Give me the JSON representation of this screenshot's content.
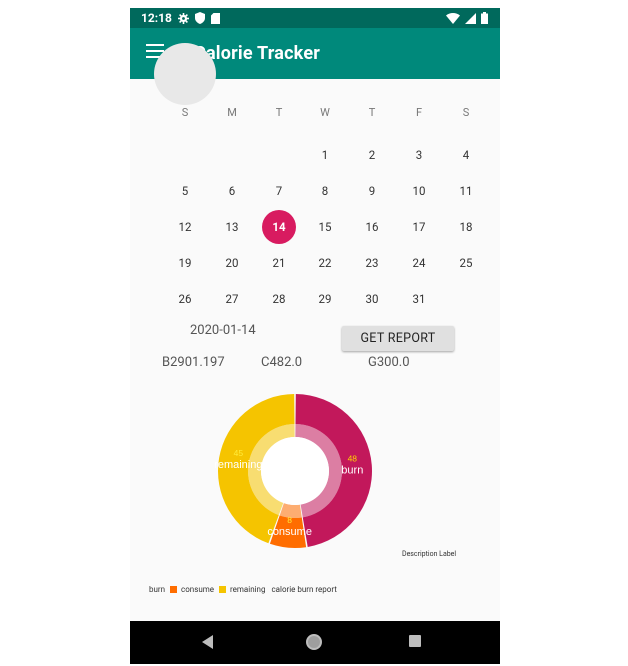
{
  "status_bar": {
    "time": "12:18",
    "icons": [
      "gear-icon",
      "shield-icon",
      "sim-card-icon",
      "wifi-icon",
      "cell-signal-icon",
      "battery-icon"
    ]
  },
  "app_bar": {
    "title": "Calorie Tracker",
    "menu_icon": "hamburger-menu-icon"
  },
  "calendar": {
    "weekdays": [
      "S",
      "M",
      "T",
      "W",
      "T",
      "F",
      "S"
    ],
    "weeks": [
      [
        "",
        "",
        "",
        "1",
        "2",
        "3",
        "4"
      ],
      [
        "5",
        "6",
        "7",
        "8",
        "9",
        "10",
        "11"
      ],
      [
        "12",
        "13",
        "14",
        "15",
        "16",
        "17",
        "18"
      ],
      [
        "19",
        "20",
        "21",
        "22",
        "23",
        "24",
        "25"
      ],
      [
        "26",
        "27",
        "28",
        "29",
        "30",
        "31",
        ""
      ]
    ],
    "selected_day": "14"
  },
  "report": {
    "date": "2020-01-14",
    "button_label": "GET REPORT",
    "burn": "B2901.197",
    "consume": "C482.0",
    "goal": "G300.0"
  },
  "chart_data": {
    "type": "pie",
    "categories": [
      "burn",
      "consume",
      "remaining"
    ],
    "values": [
      48,
      8,
      45
    ],
    "value_labels": [
      "48",
      "8",
      "45"
    ],
    "slice_labels": [
      "burn",
      "consume",
      "remaining"
    ],
    "colors": [
      "#c2185b",
      "#ff6d00",
      "#f5c400"
    ],
    "hole": true,
    "description": "Description Label",
    "legend_title": "calorie burn report",
    "legend_position": "bottom-left"
  },
  "nav_bar": {
    "back_icon": "back-triangle-icon",
    "home_icon": "home-circle-icon",
    "recents_icon": "recents-square-icon"
  }
}
